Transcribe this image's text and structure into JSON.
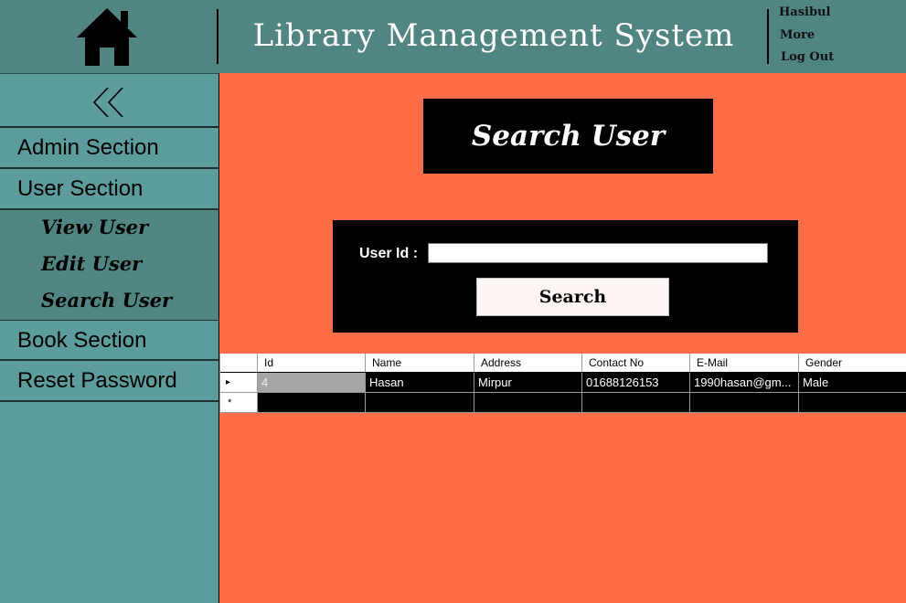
{
  "header": {
    "title": "Library Management System",
    "user_menu": [
      "Hasibul",
      "More",
      "Log Out"
    ],
    "icon": "home-icon"
  },
  "sidebar": {
    "collapse_icon": "double-chevron-left-icon",
    "items": [
      {
        "label": "Admin Section"
      },
      {
        "label": "User Section"
      },
      {
        "label": "Book Section"
      },
      {
        "label": "Reset Password"
      }
    ],
    "sub_items": [
      {
        "label": "View User"
      },
      {
        "label": "Edit User"
      },
      {
        "label": "Search User"
      }
    ]
  },
  "main": {
    "title": "Search User",
    "search": {
      "label": "User Id :",
      "value": "",
      "button": "Search"
    },
    "grid": {
      "columns": [
        "Id",
        "Name",
        "Address",
        "Contact No",
        "E-Mail",
        "Gender"
      ],
      "rows": [
        [
          "4",
          "Hasan",
          "Mirpur",
          "01688126153",
          "1990hasan@gm...",
          "Male"
        ]
      ],
      "row_marker": "▸",
      "new_row_marker": "*"
    }
  },
  "colors": {
    "header_bg": "#518581",
    "sidebar_bg": "#5d9c9c",
    "main_bg": "#ff6f47",
    "panel_bg": "#000000"
  }
}
